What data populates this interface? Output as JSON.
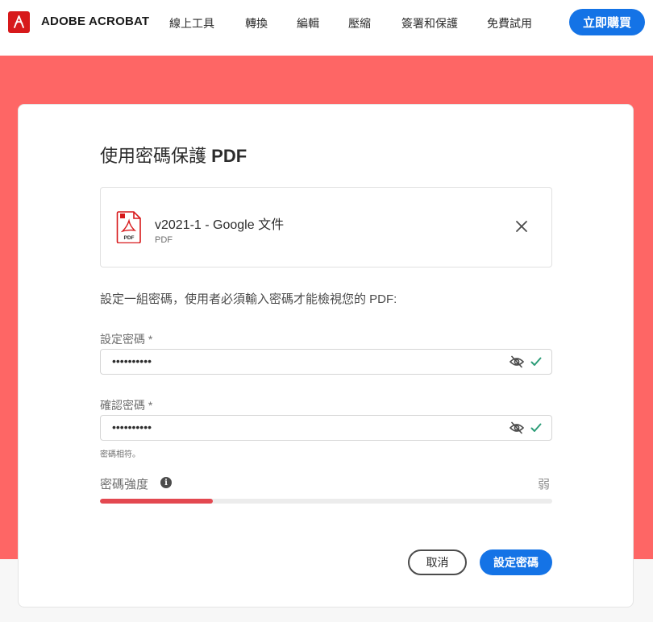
{
  "nav": {
    "brand": "ADOBE ACROBAT",
    "links": [
      "線上工具",
      "轉換",
      "編輯",
      "壓縮",
      "簽署和保護",
      "免費試用"
    ],
    "buy_label": "立即購買"
  },
  "dialog": {
    "title_prefix": "使用密碼保護",
    "title_suffix": "PDF",
    "file": {
      "name": "v2021-1 - Google 文件",
      "type": "PDF",
      "icon_text": "PDF"
    },
    "description": "設定一組密碼，使用者必須輸入密碼才能檢視您的 PDF:",
    "password": {
      "label": "設定密碼",
      "required_mark": "*",
      "value": "••••••••••"
    },
    "confirm": {
      "label": "確認密碼",
      "required_mark": "*",
      "value": "••••••••••"
    },
    "match_message": "密碼相符。",
    "strength": {
      "label": "密碼強度",
      "value": "弱",
      "fraction": 0.25
    },
    "cancel_label": "取消",
    "submit_label": "設定密碼"
  },
  "colors": {
    "accent": "#1473e6",
    "band": "#fe6665",
    "brand_red": "#d7191b",
    "strength_bar": "#e34850",
    "check": "#2d9d78"
  },
  "icons": [
    "adobe-logo-icon",
    "pdf-file-icon",
    "close-icon",
    "eye-off-icon",
    "check-icon",
    "info-icon"
  ]
}
